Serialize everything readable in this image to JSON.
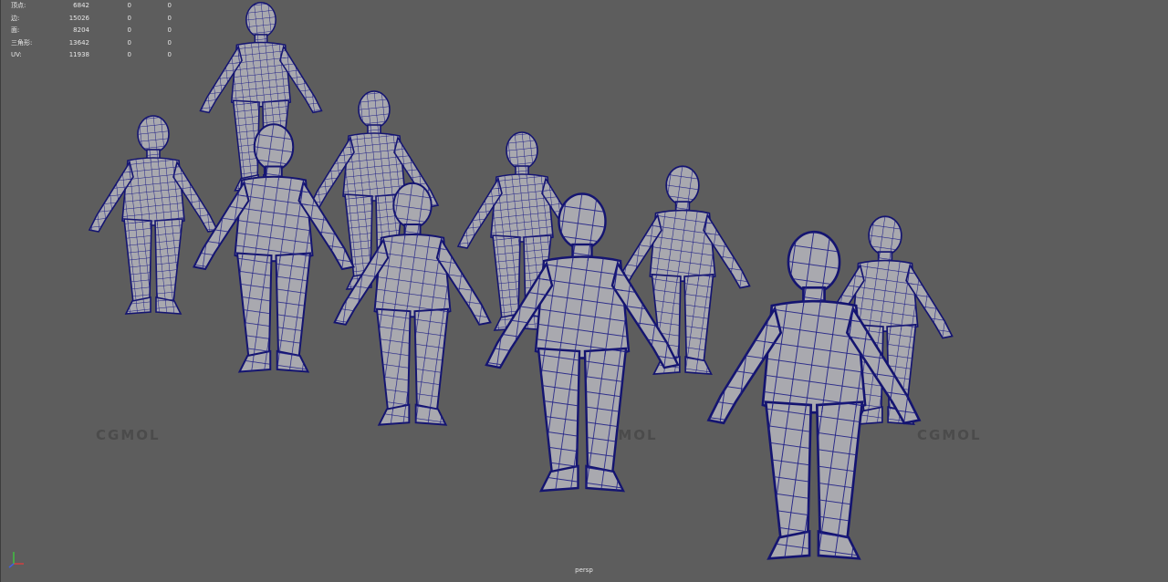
{
  "hud": {
    "rows": [
      {
        "label": "顶点:",
        "v1": "6842",
        "v2": "0",
        "v3": "0"
      },
      {
        "label": "边:",
        "v1": "15026",
        "v2": "0",
        "v3": "0"
      },
      {
        "label": "面:",
        "v1": "8204",
        "v2": "0",
        "v3": "0"
      },
      {
        "label": "三角形:",
        "v1": "13642",
        "v2": "0",
        "v3": "0"
      },
      {
        "label": "UV:",
        "v1": "11938",
        "v2": "0",
        "v3": "0"
      }
    ]
  },
  "watermarks": [
    "CGMOL",
    "CGMOL",
    "CGMOL"
  ],
  "camera": {
    "label": "persp"
  },
  "axis_icon": "xyz-axis-gizmo-icon",
  "colors": {
    "background": "#5d5d5d",
    "mesh_fill": "#a7a7ad",
    "wireframe": "#1a1a7a"
  }
}
